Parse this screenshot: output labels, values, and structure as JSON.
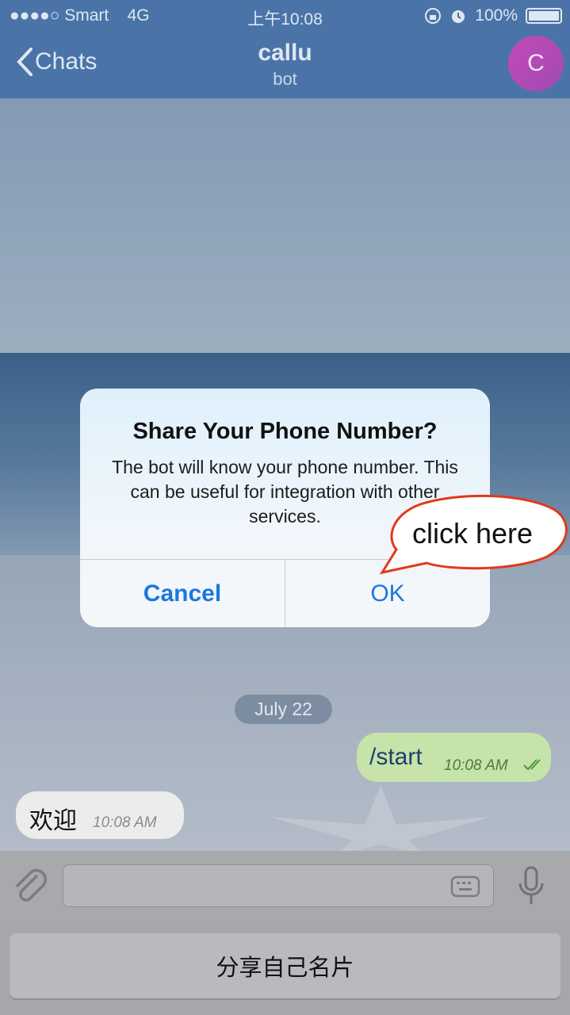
{
  "status_bar": {
    "carrier": "●●●●○ Smart",
    "network": "4G",
    "time": "上午10:08",
    "battery_pct": "100%"
  },
  "nav": {
    "back_label": "Chats",
    "title": "callu",
    "subtitle": "bot",
    "avatar_letter": "C"
  },
  "chat": {
    "date": "July 22",
    "messages": [
      {
        "direction": "out",
        "text": "/start",
        "time": "10:08 AM"
      },
      {
        "direction": "in",
        "text": "欢迎",
        "time": "10:08 AM"
      }
    ]
  },
  "alert": {
    "title": "Share Your Phone Number?",
    "message": "The bot will know your phone number. This can be useful for integration with other services.",
    "cancel_label": "Cancel",
    "ok_label": "OK"
  },
  "annotation": {
    "text": "click here"
  },
  "keyboard": {
    "share_button_label": "分享自己名片"
  },
  "colors": {
    "nav_bg": "#4a74a8",
    "alert_button": "#1a78e0",
    "outgoing_bubble": "#c6e3aa",
    "avatar": "#b24ab6",
    "callout_border": "#e0391c"
  }
}
